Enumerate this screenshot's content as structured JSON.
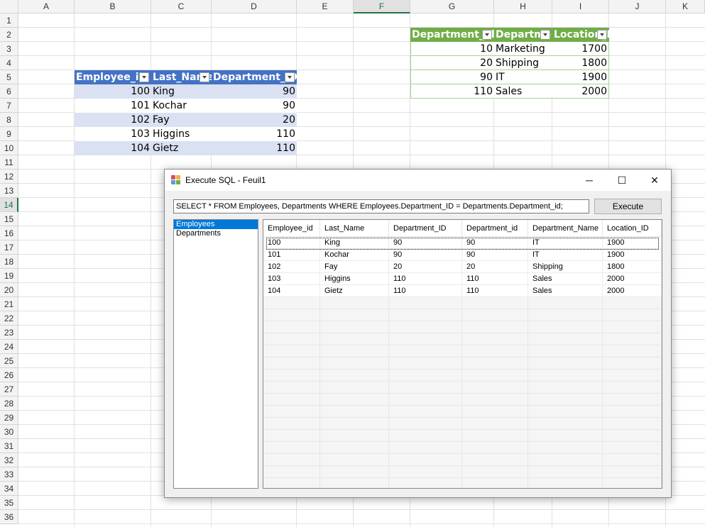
{
  "sheet": {
    "columns": [
      "A",
      "B",
      "C",
      "D",
      "E",
      "F",
      "G",
      "H",
      "I",
      "J",
      "K"
    ],
    "selected_column": "F",
    "rows": [
      "1",
      "2",
      "3",
      "4",
      "5",
      "6",
      "7",
      "8",
      "9",
      "10",
      "11",
      "12",
      "13",
      "14",
      "15",
      "16",
      "17",
      "18",
      "19",
      "20",
      "21",
      "22",
      "23",
      "24",
      "25",
      "26",
      "27",
      "28",
      "29",
      "30",
      "31",
      "32",
      "33",
      "34",
      "35",
      "36"
    ],
    "selected_row": "14",
    "employees_table": {
      "headers": [
        "Employee_id",
        "Last_Name",
        "Department_ID"
      ],
      "rows": [
        [
          "100",
          "King",
          "90"
        ],
        [
          "101",
          "Kochar",
          "90"
        ],
        [
          "102",
          "Fay",
          "20"
        ],
        [
          "103",
          "Higgins",
          "110"
        ],
        [
          "104",
          "Gietz",
          "110"
        ]
      ]
    },
    "departments_table": {
      "headers": [
        "Department_id",
        "Departme",
        "Location_I"
      ],
      "rows": [
        [
          "10",
          "Marketing",
          "1700"
        ],
        [
          "20",
          "Shipping",
          "1800"
        ],
        [
          "90",
          "IT",
          "1900"
        ],
        [
          "110",
          "Sales",
          "2000"
        ]
      ]
    },
    "colors": {
      "blue_header": "#4472c4",
      "blue_band": "#d9e1f2",
      "green_header": "#70ad47",
      "excel_accent": "#217346"
    }
  },
  "dialog": {
    "title": "Execute SQL - Feuil1",
    "minimize": "─",
    "maximize": "☐",
    "close": "✕",
    "sql_value": "SELECT * FROM Employees, Departments WHERE Employees.Department_ID = Departments.Department_id;",
    "execute_label": "Execute",
    "tables": [
      "Employees",
      "Departments"
    ],
    "selected_table": "Employees",
    "result": {
      "headers": [
        "Employee_id",
        "Last_Name",
        "Department_ID",
        "Department_id",
        "Department_Name",
        "Location_ID"
      ],
      "rows": [
        [
          "100",
          "King",
          "90",
          "90",
          "IT",
          "1900"
        ],
        [
          "101",
          "Kochar",
          "90",
          "90",
          "IT",
          "1900"
        ],
        [
          "102",
          "Fay",
          "20",
          "20",
          "Shipping",
          "1800"
        ],
        [
          "103",
          "Higgins",
          "110",
          "110",
          "Sales",
          "2000"
        ],
        [
          "104",
          "Gietz",
          "110",
          "110",
          "Sales",
          "2000"
        ]
      ]
    },
    "selection_color": "#0078d7"
  }
}
